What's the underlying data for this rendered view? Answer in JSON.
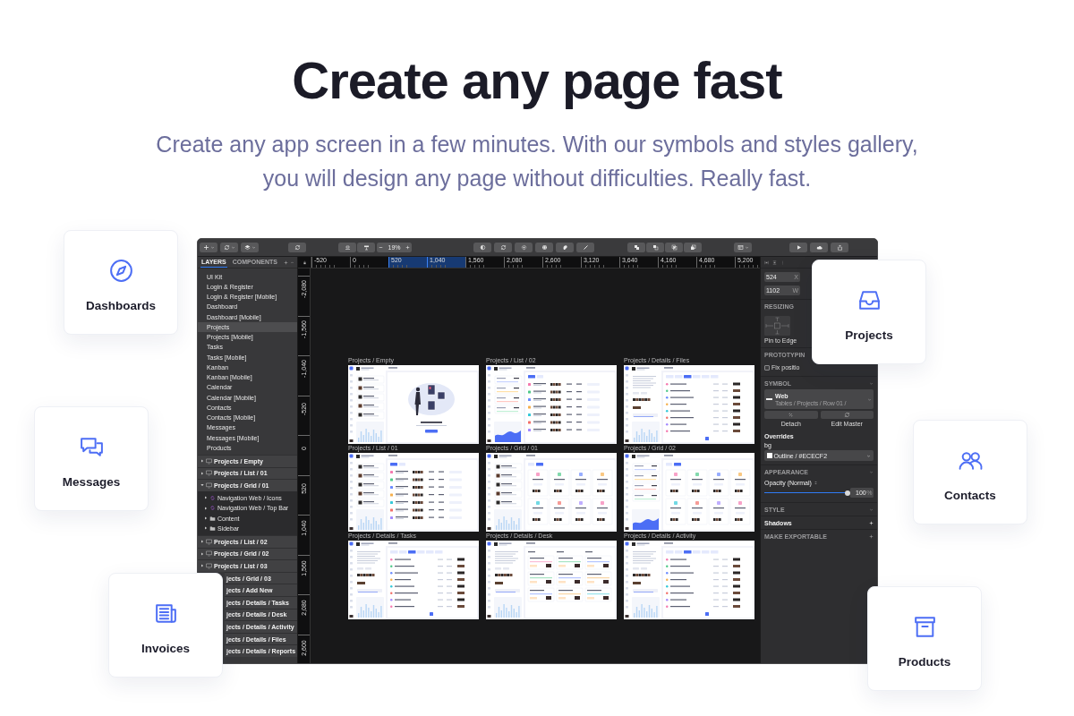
{
  "hero": {
    "title": "Create any page fast",
    "subtitle": "Create any app screen in a few minutes. With our symbols and styles gallery, you will design any page without difficulties. Really fast."
  },
  "toolbar": {
    "zoom": "19%"
  },
  "layers_panel": {
    "tabs": [
      {
        "label": "LAYERS",
        "selected": true
      },
      {
        "label": "COMPONENTS",
        "selected": false
      }
    ],
    "pages": [
      {
        "label": "UI Kit",
        "selected": false
      },
      {
        "label": "Login & Register",
        "selected": false
      },
      {
        "label": "Login & Register [Mobile]",
        "selected": false
      },
      {
        "label": "Dashboard",
        "selected": false
      },
      {
        "label": "Dashboard [Mobile]",
        "selected": false
      },
      {
        "label": "Projects",
        "selected": true
      },
      {
        "label": "Projects [Mobile]",
        "selected": false
      },
      {
        "label": "Tasks",
        "selected": false
      },
      {
        "label": "Tasks [Mobile]",
        "selected": false
      },
      {
        "label": "Kanban",
        "selected": false
      },
      {
        "label": "Kanban [Mobile]",
        "selected": false
      },
      {
        "label": "Calendar",
        "selected": false
      },
      {
        "label": "Calendar [Mobile]",
        "selected": false
      },
      {
        "label": "Contacts",
        "selected": false
      },
      {
        "label": "Contacts [Mobile]",
        "selected": false
      },
      {
        "label": "Messages",
        "selected": false
      },
      {
        "label": "Messages [Mobile]",
        "selected": false
      },
      {
        "label": "Products",
        "selected": false
      }
    ],
    "layers": [
      {
        "label": "Projects / Empty",
        "kind": "artboard",
        "expanded": false
      },
      {
        "label": "Projects / List / 01",
        "kind": "artboard",
        "expanded": false
      },
      {
        "label": "Projects / Grid / 01",
        "kind": "artboard",
        "expanded": true,
        "children": [
          {
            "label": "Navigation Web / Icons",
            "kind": "symbol",
            "expanded": false
          },
          {
            "label": "Navigation Web / Top Bar",
            "kind": "symbol",
            "expanded": false
          },
          {
            "label": "Content",
            "kind": "group",
            "expanded": false
          },
          {
            "label": "Sidebar",
            "kind": "group",
            "expanded": false
          }
        ]
      },
      {
        "label": "Projects / List / 02",
        "kind": "artboard",
        "expanded": false
      },
      {
        "label": "Projects / Grid / 02",
        "kind": "artboard",
        "expanded": false
      },
      {
        "label": "Projects / List / 03",
        "kind": "artboard",
        "expanded": false
      },
      {
        "label": "jects / Grid / 03",
        "kind": "covered"
      },
      {
        "label": "jects / Add New",
        "kind": "covered"
      },
      {
        "label": "jects / Details / Tasks",
        "kind": "covered"
      },
      {
        "label": "jects / Details / Desk",
        "kind": "covered"
      },
      {
        "label": "jects / Details / Activity",
        "kind": "covered"
      },
      {
        "label": "jects / Details / Files",
        "kind": "covered"
      },
      {
        "label": "jects / Details / Reports",
        "kind": "covered"
      }
    ]
  },
  "rulers": {
    "horizontal": [
      {
        "label": "-520",
        "selected": false
      },
      {
        "label": "0",
        "selected": false
      },
      {
        "label": "520",
        "selected": true
      },
      {
        "label": "1,040",
        "selected": true
      },
      {
        "label": "1,560",
        "selected": false
      },
      {
        "label": "2,080",
        "selected": false
      },
      {
        "label": "2,600",
        "selected": false
      },
      {
        "label": "3,120",
        "selected": false
      },
      {
        "label": "3,640",
        "selected": false
      },
      {
        "label": "4,160",
        "selected": false
      },
      {
        "label": "4,680",
        "selected": false
      },
      {
        "label": "5,200",
        "selected": false
      }
    ],
    "vertical": [
      "-2,080",
      "-1,560",
      "-1,040",
      "-520",
      "0",
      "520",
      "1,040",
      "1,560",
      "2,080",
      "2,600"
    ]
  },
  "canvas": {
    "artboards": [
      {
        "label": "Projects / Empty",
        "kind": "empty"
      },
      {
        "label": "Projects / List / 02",
        "kind": "list-stats"
      },
      {
        "label": "Projects / Details / Files",
        "kind": "details"
      },
      {
        "label": "Projects / List / 01",
        "kind": "list"
      },
      {
        "label": "Projects / Grid / 01",
        "kind": "grid"
      },
      {
        "label": "Projects / Grid / 02",
        "kind": "grid-stats"
      },
      {
        "label": "Projects / Details / Tasks",
        "kind": "details"
      },
      {
        "label": "Projects / Details / Desk",
        "kind": "board"
      },
      {
        "label": "Projects / Details / Activity",
        "kind": "details"
      }
    ]
  },
  "inspector": {
    "fields": [
      {
        "value": "524",
        "label": "X"
      },
      {
        "value": "1102",
        "label": "W"
      }
    ],
    "resizing": {
      "title": "RESIZING",
      "caption": "Pin to Edge"
    },
    "prototyping": {
      "title": "PROTOTYPIN",
      "checkbox": {
        "label": "Fix positio",
        "checked": false
      }
    },
    "symbol": {
      "title": "SYMBOL",
      "name": "Web",
      "path": "Tables / Projects / Row 01 /",
      "actions": [
        "Detach",
        "Edit Master"
      ]
    },
    "overrides": {
      "title": "Overrides",
      "label": "bg",
      "value": "Outline / #ECECF2"
    },
    "appearance": {
      "title": "APPEARANCE",
      "label": "Opacity (Normal)",
      "level": 1.0,
      "value": "100",
      "unit": "%"
    },
    "sections": [
      {
        "title": "STYLE",
        "kind": "header"
      },
      {
        "title": "Shadows",
        "kind": "item"
      },
      {
        "title": "MAKE EXPORTABLE",
        "kind": "header-add"
      }
    ]
  },
  "feature_cards": [
    {
      "label": "Dashboards",
      "kind": "compass"
    },
    {
      "label": "Messages",
      "kind": "chat"
    },
    {
      "label": "Invoices",
      "kind": "newspaper"
    },
    {
      "label": "Projects",
      "kind": "inbox"
    },
    {
      "label": "Contacts",
      "kind": "people"
    },
    {
      "label": "Products",
      "kind": "box"
    }
  ]
}
